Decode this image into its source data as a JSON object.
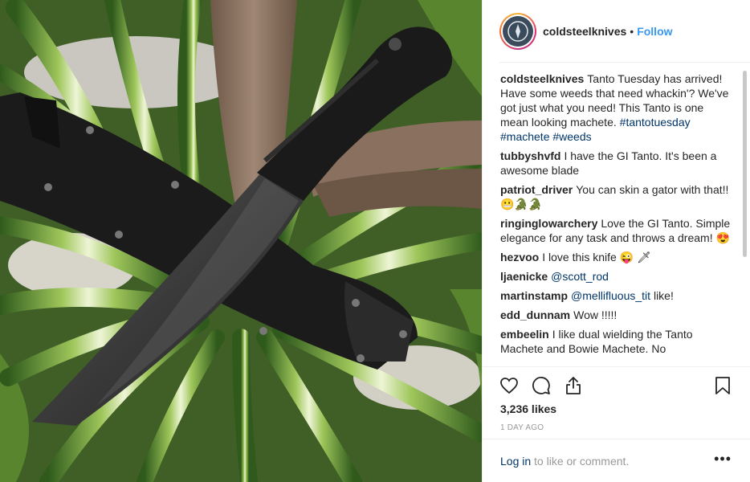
{
  "post": {
    "username": "coldsteelknives",
    "dot": "•",
    "follow_label": "Follow",
    "caption_user": "coldsteelknives",
    "caption_text": "Tanto Tuesday has arrived! Have some weeds that need whackin'? We've got just what you need! This Tanto is one mean looking machete.",
    "caption_hashtags": "#tantotuesday #machete #weeds",
    "likes": "3,236 likes",
    "time": "1 DAY AGO",
    "login_link": "Log in",
    "login_text": "to like or comment.",
    "more_label": "•••"
  },
  "comments": [
    {
      "user": "tubbyshvfd",
      "text": "I have the GI Tanto. It's been a awesome blade"
    },
    {
      "user": "patriot_driver",
      "text": "You can skin a gator with that!! 😬🐊🐊"
    },
    {
      "user": "ringinglowarchery",
      "text": "Love the GI Tanto. Simple elegance for any task and throws a dream! 😍"
    },
    {
      "user": "hezvoo",
      "text": "I love this knife 😜 🗡"
    },
    {
      "user": "ljaenicke",
      "mention": "@scott_rod",
      "text": ""
    },
    {
      "user": "martinstamp",
      "mention": "@mellifluous_tit",
      "text": "like!"
    },
    {
      "user": "edd_dunnam",
      "text": "Wow !!!!!"
    },
    {
      "user": "embeelin",
      "text": "I like dual wielding the Tanto Machete and Bowie Machete. No"
    }
  ],
  "icons": {
    "like": "heart-icon",
    "comment": "comment-icon",
    "share": "share-icon",
    "save": "bookmark-icon",
    "more": "more-options-icon"
  },
  "colors": {
    "link": "#3897f0",
    "hashtag": "#003569",
    "muted": "#999999"
  }
}
